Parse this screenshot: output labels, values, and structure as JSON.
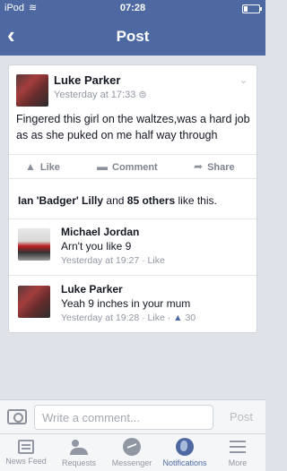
{
  "status_bar": {
    "carrier": "iPod",
    "wifi_icon": "wifi-icon",
    "time": "07:28",
    "battery_icon": "battery-icon"
  },
  "nav": {
    "back_icon": "chevron-left-icon",
    "back_glyph": "‹",
    "title": "Post"
  },
  "post": {
    "author": "Luke Parker",
    "time": "Yesterday at 17:33",
    "privacy_icon": "friends-icon",
    "privacy_glyph": "⊜",
    "menu_glyph": "⌄",
    "text": "Fingered this girl on the waltzes,was a hard job as as she puked on me half way through"
  },
  "actions": {
    "like_label": "Like",
    "like_glyph": "▮◤",
    "comment_label": "Comment",
    "comment_glyph": "▬",
    "share_label": "Share",
    "share_glyph": "➦"
  },
  "likes": {
    "name": "Ian 'Badger' Lilly",
    "and": "and",
    "others": "85 others",
    "suffix": "like this."
  },
  "comments": [
    {
      "author": "Michael Jordan",
      "text": "Arn't you like 9",
      "time": "Yesterday at 19:27",
      "dot": "·",
      "like": "Like",
      "count": ""
    },
    {
      "author": "Luke Parker",
      "text": "Yeah 9 inches in your mum",
      "time": "Yesterday at 19:28",
      "dot": "·",
      "like": "Like",
      "dot2": "·",
      "thumb_glyph": "👍",
      "count": "30"
    }
  ],
  "composer": {
    "placeholder": "Write a comment...",
    "post_label": "Post",
    "camera_icon": "camera-icon"
  },
  "tabs": [
    {
      "label": "News Feed",
      "icon": "news-feed-icon"
    },
    {
      "label": "Requests",
      "icon": "friend-requests-icon"
    },
    {
      "label": "Messenger",
      "icon": "messenger-icon"
    },
    {
      "label": "Notifications",
      "icon": "globe-icon"
    },
    {
      "label": "More",
      "icon": "menu-icon"
    }
  ],
  "colors": {
    "brand": "#4e69a2",
    "background": "#dfe2e8",
    "muted": "#9197a3"
  }
}
